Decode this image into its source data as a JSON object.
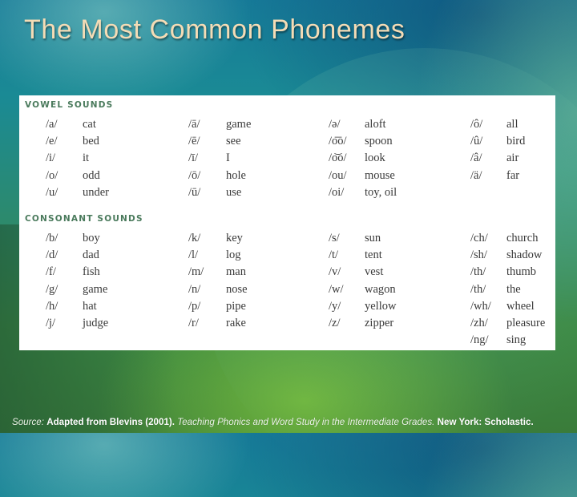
{
  "slide": {
    "title": "The Most Common Phonemes"
  },
  "vowels": {
    "heading": "VOWEL SOUNDS",
    "columns": [
      [
        {
          "symbol": "/a/",
          "example": "cat"
        },
        {
          "symbol": "/e/",
          "example": "bed"
        },
        {
          "symbol": "/i/",
          "example": "it"
        },
        {
          "symbol": "/o/",
          "example": "odd"
        },
        {
          "symbol": "/u/",
          "example": "under"
        }
      ],
      [
        {
          "symbol": "/ā/",
          "example": "game"
        },
        {
          "symbol": "/ē/",
          "example": "see"
        },
        {
          "symbol": "/ī/",
          "example": "I"
        },
        {
          "symbol": "/ō/",
          "example": "hole"
        },
        {
          "symbol": "/ū/",
          "example": "use"
        }
      ],
      [
        {
          "symbol": "/ə/",
          "example": "aloft"
        },
        {
          "symbol": "/o͞o/",
          "example": "spoon"
        },
        {
          "symbol": "/o͝o/",
          "example": "look"
        },
        {
          "symbol": "/ou/",
          "example": "mouse"
        },
        {
          "symbol": "/oi/",
          "example": "toy, oil"
        }
      ],
      [
        {
          "symbol": "/ô/",
          "example": "all"
        },
        {
          "symbol": "/û/",
          "example": "bird"
        },
        {
          "symbol": "/â/",
          "example": "air"
        },
        {
          "symbol": "/ä/",
          "example": "far"
        }
      ]
    ]
  },
  "consonants": {
    "heading": "CONSONANT SOUNDS",
    "columns": [
      [
        {
          "symbol": "/b/",
          "example": "boy"
        },
        {
          "symbol": "/d/",
          "example": "dad"
        },
        {
          "symbol": "/f/",
          "example": "fish"
        },
        {
          "symbol": "/g/",
          "example": "game"
        },
        {
          "symbol": "/h/",
          "example": "hat"
        },
        {
          "symbol": "/j/",
          "example": "judge"
        }
      ],
      [
        {
          "symbol": "/k/",
          "example": "key"
        },
        {
          "symbol": "/l/",
          "example": "log"
        },
        {
          "symbol": "/m/",
          "example": "man"
        },
        {
          "symbol": "/n/",
          "example": "nose"
        },
        {
          "symbol": "/p/",
          "example": "pipe"
        },
        {
          "symbol": "/r/",
          "example": "rake"
        }
      ],
      [
        {
          "symbol": "/s/",
          "example": "sun"
        },
        {
          "symbol": "/t/",
          "example": "tent"
        },
        {
          "symbol": "/v/",
          "example": "vest"
        },
        {
          "symbol": "/w/",
          "example": "wagon"
        },
        {
          "symbol": "/y/",
          "example": "yellow"
        },
        {
          "symbol": "/z/",
          "example": "zipper"
        }
      ],
      [
        {
          "symbol": "/ch/",
          "example": "church"
        },
        {
          "symbol": "/sh/",
          "example": "shadow"
        },
        {
          "symbol": "/th/",
          "example": "thumb"
        },
        {
          "symbol": "/th/",
          "example": "the"
        },
        {
          "symbol": "/wh/",
          "example": "wheel"
        },
        {
          "symbol": "/zh/",
          "example": "pleasure"
        },
        {
          "symbol": "/ng/",
          "example": "sing"
        }
      ]
    ]
  },
  "footer": {
    "source_label": "Source:",
    "adapted": "Adapted from Blevins (2001).",
    "book_title": "Teaching Phonics and Word Study in the Intermediate Grades.",
    "publisher": "New York: Scholastic."
  },
  "colors": {
    "title": "#f4dcb6",
    "section_heading": "#4a7a5c",
    "body_text": "#3a3a3a",
    "panel": "#ffffff"
  }
}
